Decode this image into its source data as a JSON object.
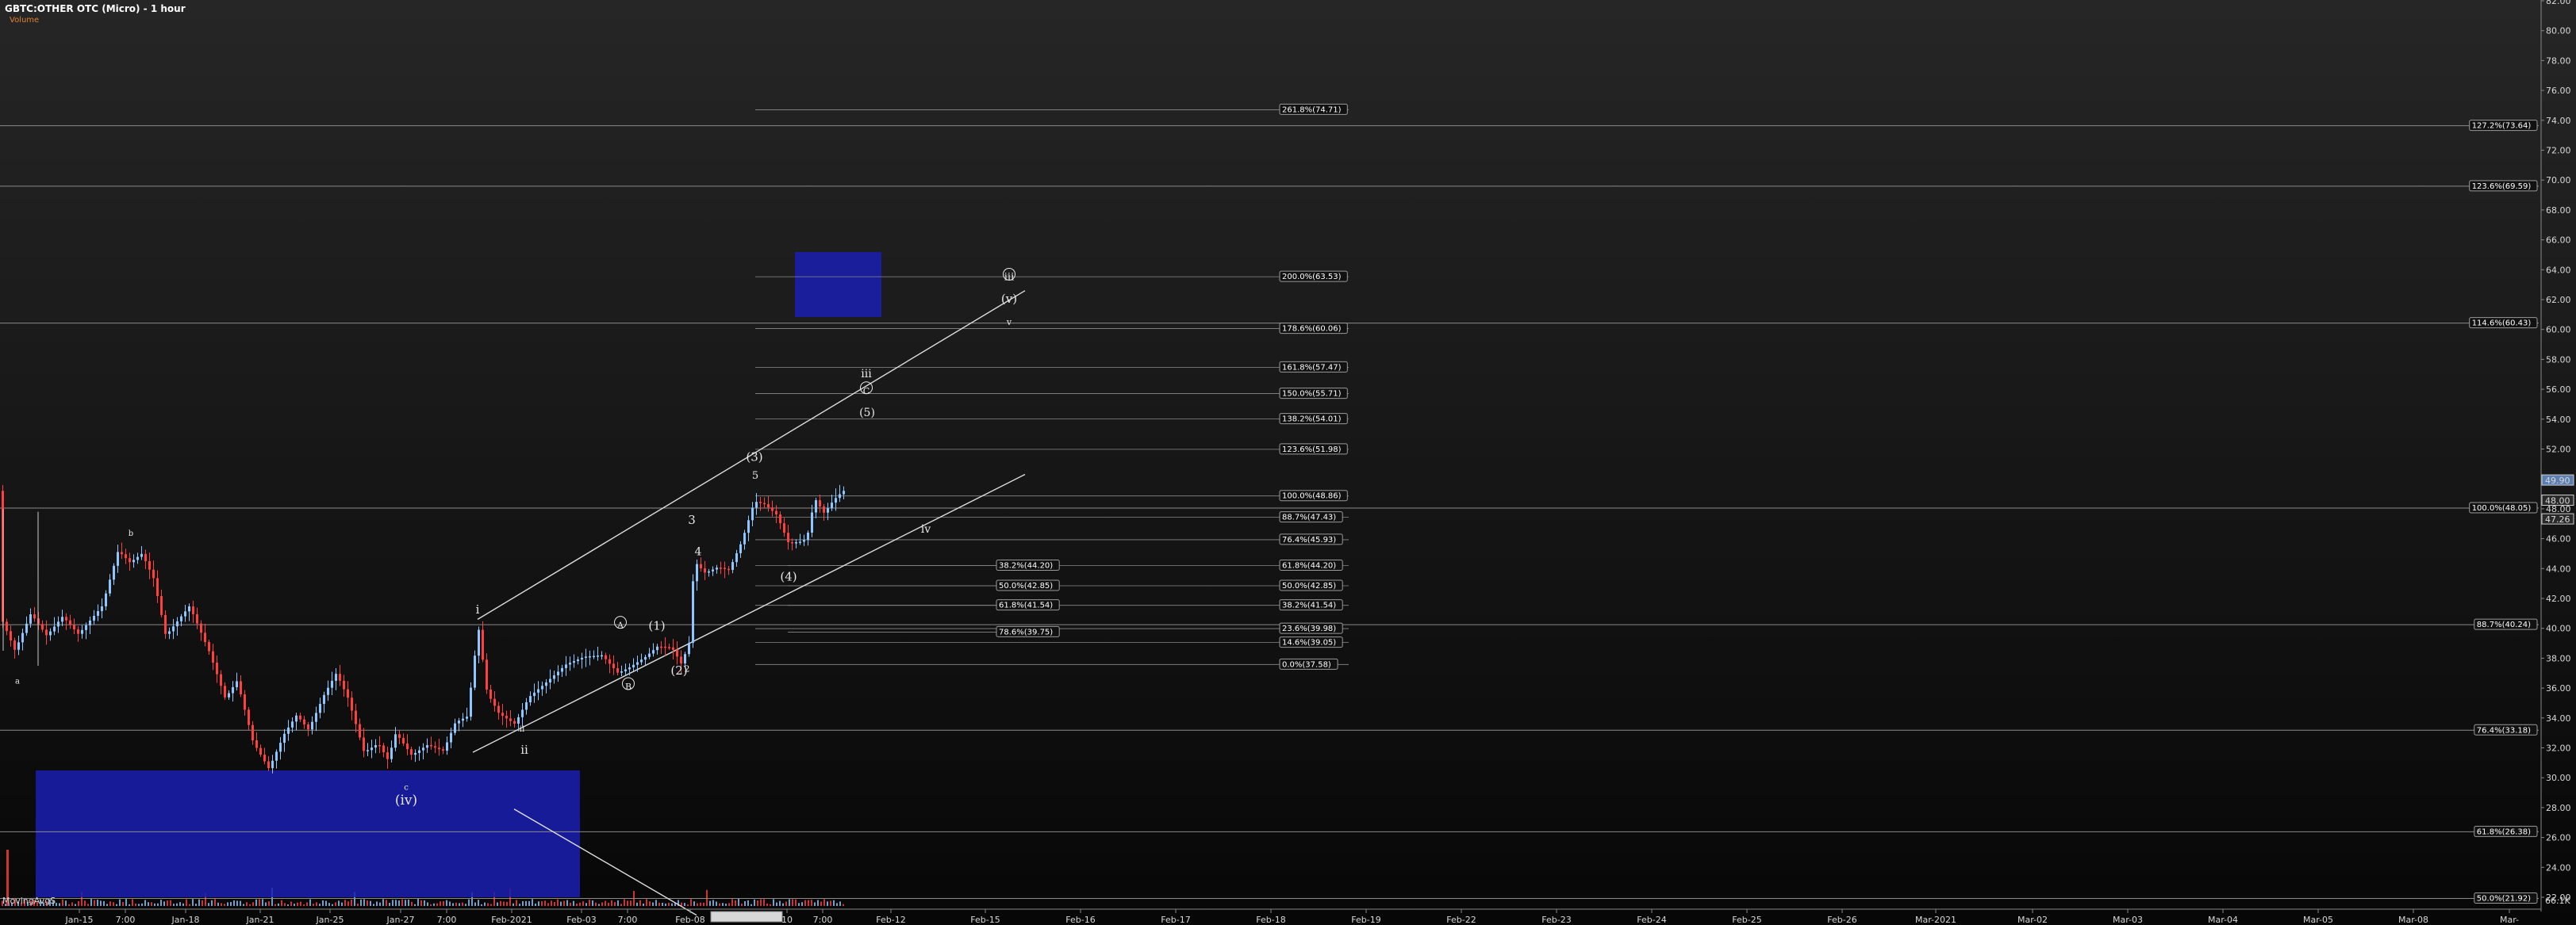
{
  "header": {
    "title": "GBTC:OTHER OTC (Micro) - 1 hour",
    "volume_label": "Volume"
  },
  "colors": {
    "background_top": "#262626",
    "background_bottom": "#070707",
    "up_candle": "#8fc6ff",
    "down_candle": "#ff4040",
    "box_fill": "#1a1fb0",
    "trend_line": "#dddddd",
    "fib_line": "#8a8a8a",
    "volume_label": "#e0822e"
  },
  "chart_data": {
    "type": "candlestick",
    "title": "GBTC:OTHER OTC (Micro) - 1 hour",
    "xlabel": "",
    "ylabel": "",
    "ylim": [
      19.8,
      83
    ],
    "y_ticks": [
      22,
      24,
      26,
      28,
      30,
      32,
      34,
      36,
      38,
      40,
      42,
      44,
      46,
      48,
      50,
      52,
      54,
      56,
      58,
      60,
      62,
      64,
      66,
      68,
      70,
      72,
      74,
      76,
      78,
      80,
      82
    ],
    "x_ticks": [
      "Jan-15",
      "7:00",
      "Jan-18",
      "Jan-21",
      "Jan-25",
      "Jan-27",
      "7:00",
      "Feb-2021",
      "Feb-03",
      "7:00",
      "Feb-08",
      "10",
      "7:00",
      "Feb-12",
      "Feb-15",
      "Feb-16",
      "Feb-17",
      "Feb-18",
      "Feb-19",
      "Feb-22",
      "Feb-23",
      "Feb-24",
      "Feb-25",
      "Feb-26",
      "Mar-2021",
      "Mar-02",
      "Mar-03",
      "Mar-04",
      "Mar-05",
      "Mar-08",
      "Mar-"
    ],
    "price_markers": [
      {
        "label": "49.90",
        "value": 49.9
      },
      {
        "label": "48.00",
        "value": 48.55
      },
      {
        "label": "47.26",
        "value": 47.3
      }
    ],
    "bottom_labels": [
      "MovingAvgS",
      "BullBearTrend",
      "66.1K"
    ],
    "grid": false,
    "legend": "none",
    "volume_visible": true
  },
  "fib_right": [
    {
      "label": "127.2%(73.64)",
      "value": 73.64
    },
    {
      "label": "123.6%(69.59)",
      "value": 69.59
    },
    {
      "label": "114.6%(60.43)",
      "value": 60.43
    },
    {
      "label": "100.0%(48.05)",
      "value": 48.05
    },
    {
      "label": "88.7%(40.24)",
      "value": 40.24
    },
    {
      "label": "76.4%(33.18)",
      "value": 33.18
    },
    {
      "label": "61.8%(26.38)",
      "value": 26.38
    },
    {
      "label": "50.0%(21.92)",
      "value": 21.92
    }
  ],
  "fib_mid_ext": [
    {
      "label": "261.8%(74.71)",
      "value": 74.71
    },
    {
      "label": "200.0%(63.53)",
      "value": 63.53
    },
    {
      "label": "178.6%(60.06)",
      "value": 60.06
    },
    {
      "label": "161.8%(57.47)",
      "value": 57.47
    },
    {
      "label": "150.0%(55.71)",
      "value": 55.71
    },
    {
      "label": "138.2%(54.01)",
      "value": 54.01
    },
    {
      "label": "123.6%(51.98)",
      "value": 51.98
    },
    {
      "label": "100.0%(48.86)",
      "value": 48.86
    },
    {
      "label": "88.7%(47.43)",
      "value": 47.43
    },
    {
      "label": "76.4%(45.93)",
      "value": 45.93
    },
    {
      "label": "61.8%(44.20)",
      "value": 44.2
    },
    {
      "label": "50.0%(42.85)",
      "value": 42.85
    },
    {
      "label": "38.2%(41.54)",
      "value": 41.54
    },
    {
      "label": "23.6%(39.98)",
      "value": 39.98
    },
    {
      "label": "14.6%(39.05)",
      "value": 39.05
    },
    {
      "label": "0.0%(37.58)",
      "value": 37.58
    }
  ],
  "fib_left_ret": [
    {
      "label": "38.2%(44.20)",
      "value": 44.2
    },
    {
      "label": "50.0%(42.85)",
      "value": 42.85
    },
    {
      "label": "61.8%(41.54)",
      "value": 41.54
    },
    {
      "label": "78.6%(39.75)",
      "value": 39.75
    }
  ],
  "wave_labels": {
    "iv_paren": "(iv)",
    "c": "c",
    "a": "a",
    "b": "b",
    "i": "i",
    "ii": "ii",
    "ii_small": "ii",
    "A": "A",
    "B": "B",
    "one_paren": "(1)",
    "two_paren": "(2)",
    "two_small": "2",
    "three": "3",
    "four": "4",
    "three_paren": "(3)",
    "five": "5",
    "four_paren": "(4)",
    "iii": "iii",
    "C": "C",
    "five_paren": "(5)",
    "iii_circled": "iii",
    "v_paren": "(v)",
    "v": "v",
    "iv": "iv"
  }
}
